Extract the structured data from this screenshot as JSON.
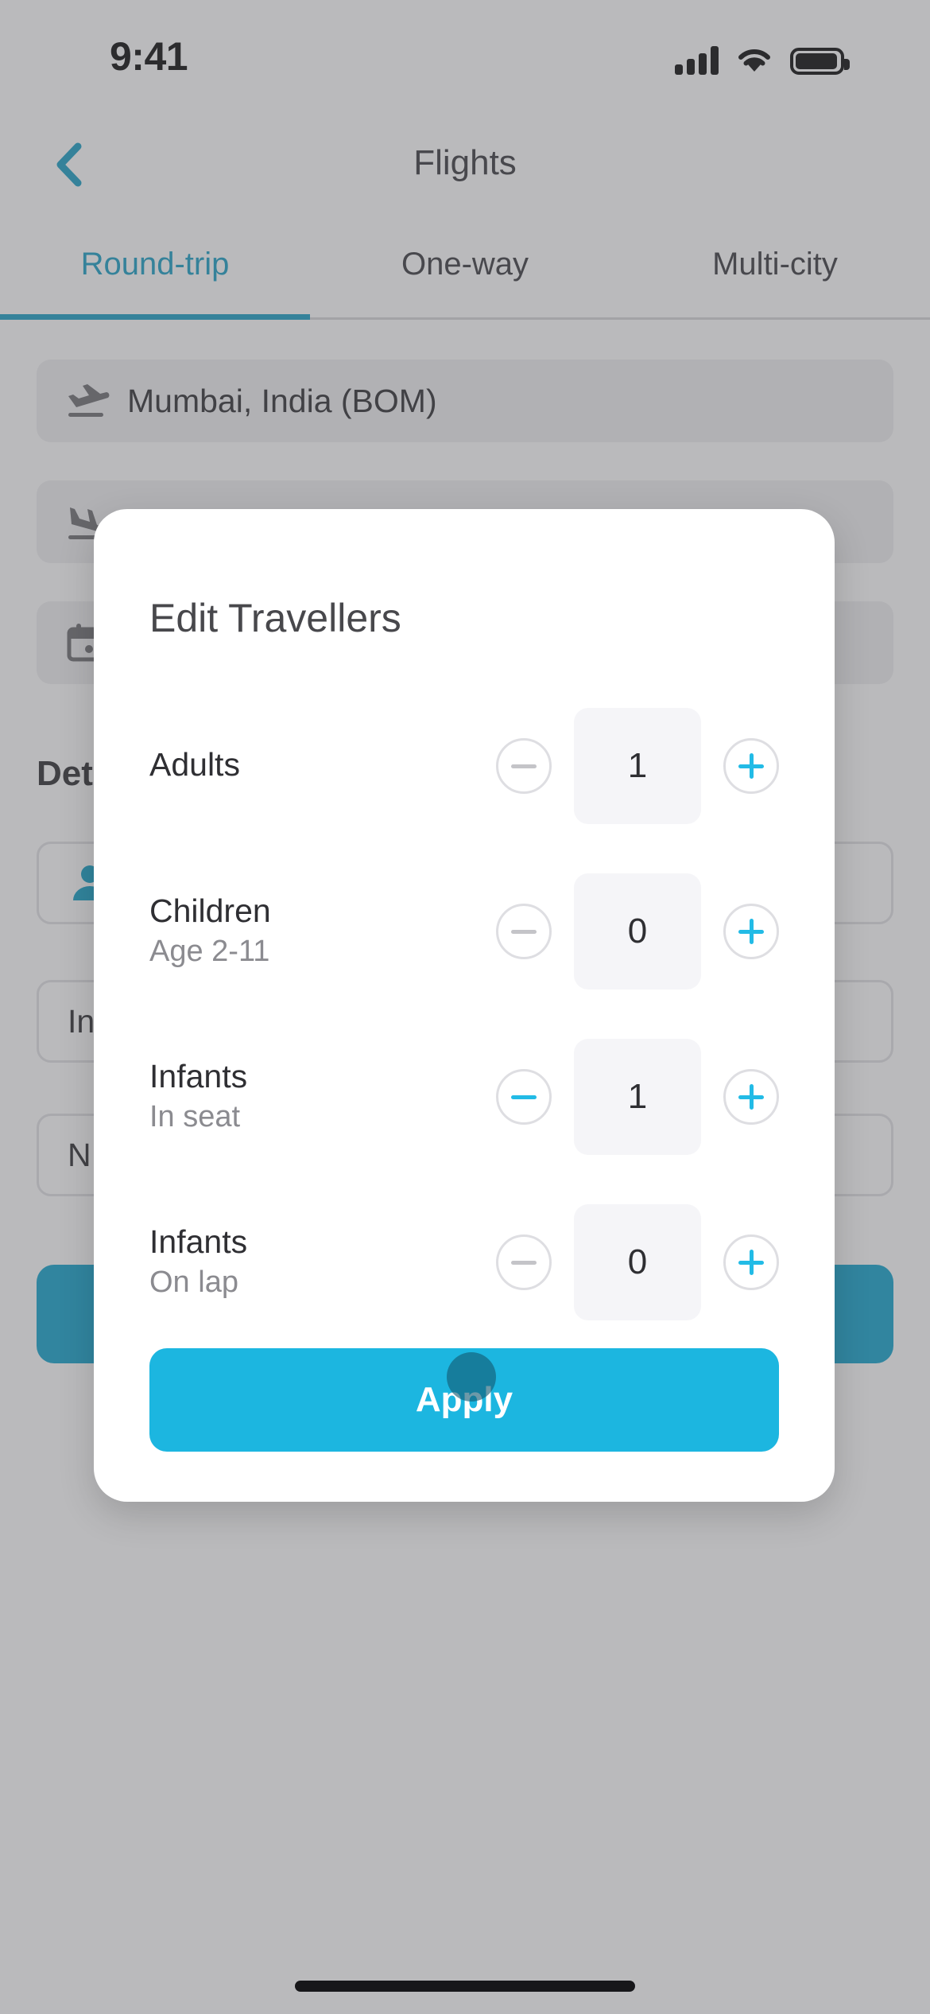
{
  "status_bar": {
    "time": "9:41",
    "signal_icon": "cellular-signal-icon",
    "wifi_icon": "wifi-icon",
    "battery_icon": "battery-full-icon"
  },
  "nav": {
    "back_icon": "chevron-left-icon",
    "title": "Flights"
  },
  "tabs": [
    {
      "label": "Round-trip",
      "active": true
    },
    {
      "label": "One-way",
      "active": false
    },
    {
      "label": "Multi-city",
      "active": false
    }
  ],
  "search_form": {
    "origin": {
      "value": "Mumbai, India (BOM)",
      "icon": "flight-takeoff-icon"
    },
    "destination": {
      "value": "",
      "icon": "flight-land-icon"
    },
    "dates": {
      "value": "",
      "icon": "calendar-icon"
    },
    "section_label": "Details",
    "travellers": {
      "value": "",
      "icon": "person-icon"
    },
    "cabin_class": {
      "value": "In",
      "icon": ""
    },
    "airline": {
      "value": "N",
      "icon": ""
    },
    "search_label": ""
  },
  "modal": {
    "title": "Edit Travellers",
    "rows": [
      {
        "title": "Adults",
        "subtitle": "",
        "value": "1",
        "minus_enabled": false,
        "plus_enabled": true
      },
      {
        "title": "Children",
        "subtitle": "Age 2-11",
        "value": "0",
        "minus_enabled": false,
        "plus_enabled": true
      },
      {
        "title": "Infants",
        "subtitle": "In seat",
        "value": "1",
        "minus_enabled": true,
        "plus_enabled": true
      },
      {
        "title": "Infants",
        "subtitle": "On lap",
        "value": "0",
        "minus_enabled": false,
        "plus_enabled": true
      }
    ],
    "apply_label": "Apply",
    "minus_icon": "minus-circle-icon",
    "plus_icon": "plus-circle-icon"
  },
  "colors": {
    "accent_cyan": "#1cb6e0",
    "tab_active": "#1a9fc4",
    "disabled_gray": "#c4c4c8",
    "value_box_bg": "#f5f5f8",
    "scrim": "rgba(90,90,95,0.42)"
  },
  "touch_indicator": {
    "name": "touch-point"
  },
  "home_indicator": {
    "name": "home-indicator"
  }
}
